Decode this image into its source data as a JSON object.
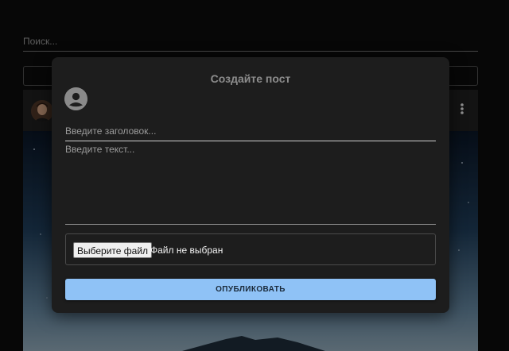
{
  "search": {
    "placeholder": "Поиск..."
  },
  "post": {
    "menu_icon": "more-vert-icon"
  },
  "modal": {
    "title": "Создайте пост",
    "avatar_icon": "account-circle-icon",
    "title_placeholder": "Введите заголовок...",
    "text_placeholder": "Введите текст...",
    "file_button_label": "Выберите файл",
    "file_status": "Файл не выбран",
    "publish_label": "ОПУБЛИКОВАТЬ"
  },
  "colors": {
    "accent": "#8fc2f6",
    "modal_background": "#1d1d1d",
    "page_background": "#0c0c0c"
  }
}
